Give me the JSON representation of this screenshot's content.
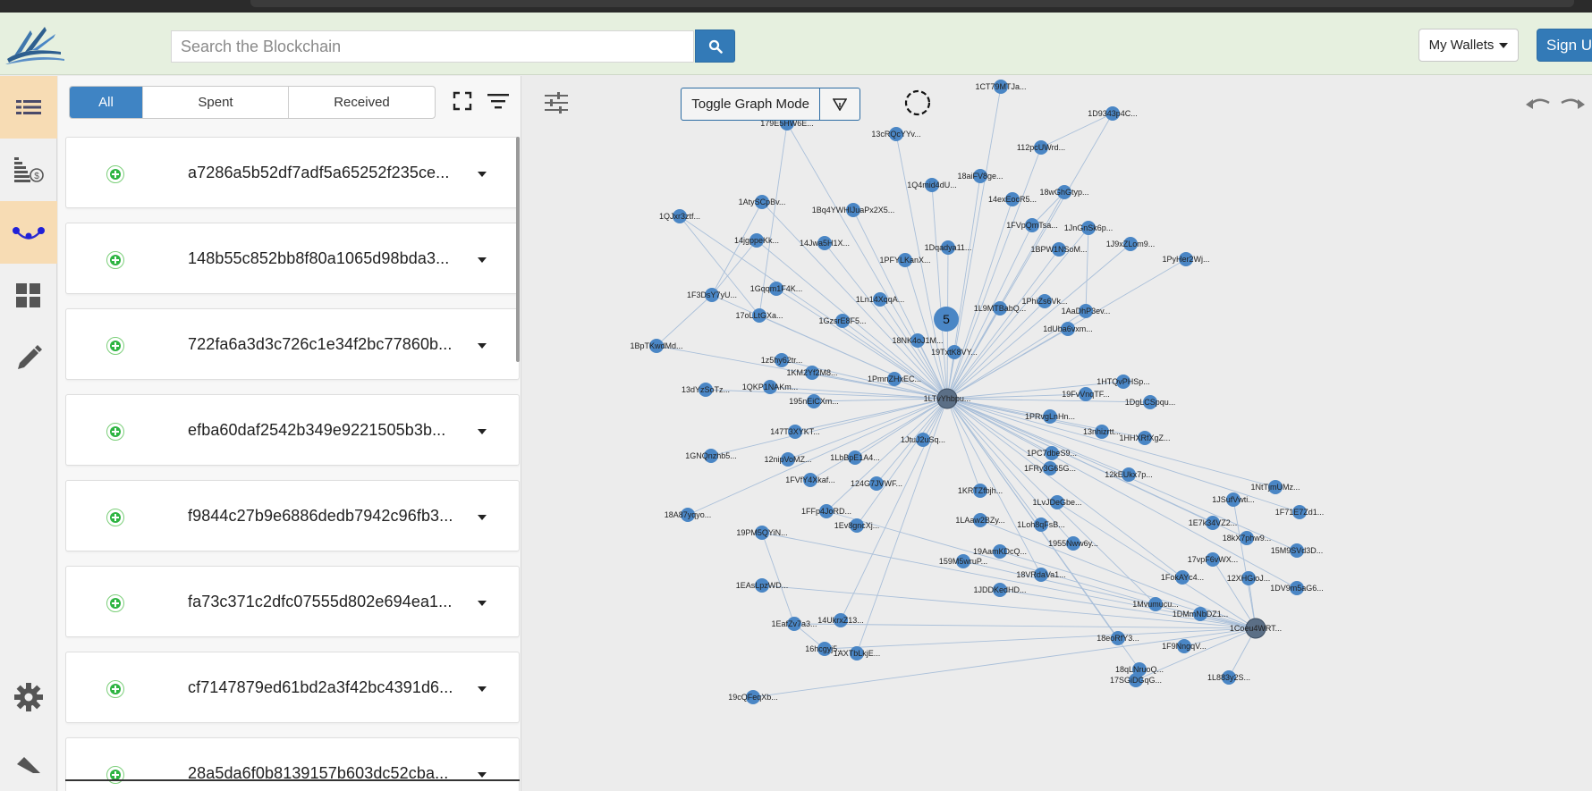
{
  "header": {
    "search_placeholder": "Search the Blockchain",
    "wallets_label": "My Wallets",
    "signup_label": "Sign Up"
  },
  "filters": {
    "all": "All",
    "spent": "Spent",
    "received": "Received"
  },
  "transactions": [
    "a7286a5b52df7adf5a65252f235ce...",
    "148b55c852bb8f80a1065d98bda3...",
    "722fa6a3d3c726c1e34f2bc77860b...",
    "efba60daf2542b349e9221505b3b...",
    "f9844c27b9e6886dedb7942c96fb3...",
    "fa73c371c2dfc07555d802e694ea1...",
    "cf7147879ed61bd2a3f42bc4391d6...",
    "28a5da6f0b8139157b603dc52cba..."
  ],
  "graph": {
    "toggle_label": "Toggle Graph Mode",
    "cluster_count": "5",
    "hubs": [
      {
        "id": "h1",
        "label": "1LTvYhbpu..."
      },
      {
        "id": "h2",
        "label": "1Coeu4WRT..."
      }
    ],
    "nodes": [
      {
        "label": "1CT79MTJa...",
        "hub": "h1"
      },
      {
        "label": "1D9343p4C...",
        "hub": "h1"
      },
      {
        "label": "179E5HW6E...",
        "hub": "h1"
      },
      {
        "label": "13cRQcYYv...",
        "hub": "h1"
      },
      {
        "label": "112pcUWrd...",
        "hub": "h1"
      },
      {
        "label": "18aiFV8ge...",
        "hub": "h1"
      },
      {
        "label": "1Q4mid4dU...",
        "hub": "h1"
      },
      {
        "label": "18wGhGtyp...",
        "hub": "h1"
      },
      {
        "label": "14exEocR5...",
        "hub": "h1"
      },
      {
        "label": "1AtySCpBv...",
        "hub": "h1"
      },
      {
        "label": "1Bq4YWHlJuaPx2X5...",
        "hub": "h1"
      },
      {
        "label": "1QJxr3ztf...",
        "hub": "h1"
      },
      {
        "label": "1FVpQmTsa...",
        "hub": "h1"
      },
      {
        "label": "1JnGnSk6p...",
        "hub": "h1"
      },
      {
        "label": "14jgppeKk...",
        "hub": "h1"
      },
      {
        "label": "14Jwa5H1X...",
        "hub": "h1"
      },
      {
        "label": "1Dqadya11...",
        "hub": "h1"
      },
      {
        "label": "1BPW1NSoM...",
        "hub": "h1"
      },
      {
        "label": "1J9xZLom9...",
        "hub": "h1"
      },
      {
        "label": "1PFYLKanX...",
        "hub": "h1"
      },
      {
        "label": "1PyHer2Wj...",
        "hub": "h1"
      },
      {
        "label": "1F3DsY7yU...",
        "hub": "h1"
      },
      {
        "label": "1Gqqm1F4K...",
        "hub": "h1"
      },
      {
        "label": "1Ln14XqqA...",
        "hub": "h1"
      },
      {
        "label": "1L9MTBabQ...",
        "hub": "h1"
      },
      {
        "label": "1PhiZs6Vk...",
        "hub": "h1"
      },
      {
        "label": "1AaDhP3ev...",
        "hub": "h1"
      },
      {
        "label": "17oLLtGXa...",
        "hub": "h1"
      },
      {
        "label": "1GzsrE8F5...",
        "hub": "h1"
      },
      {
        "label": "1dUba6vxm...",
        "hub": "h1"
      },
      {
        "label": "1BpTKwdMd...",
        "hub": "h1"
      },
      {
        "label": "18NK4oJ1M...",
        "hub": "h1"
      },
      {
        "label": "19TxtK8VY...",
        "hub": "h1"
      },
      {
        "label": "1z5hy62tr...",
        "hub": "h1"
      },
      {
        "label": "1KM2Yf2M8...",
        "hub": "h1"
      },
      {
        "label": "1PmnZHxEC...",
        "hub": "h1"
      },
      {
        "label": "13dYzSoTz...",
        "hub": "h1"
      },
      {
        "label": "1QKP1NAKm...",
        "hub": "h1"
      },
      {
        "label": "1HTQvPHSp...",
        "hub": "h1"
      },
      {
        "label": "195nEiCXm...",
        "hub": "h1"
      },
      {
        "label": "19FvVnqTF...",
        "hub": "h1"
      },
      {
        "label": "1DgLCSpqu...",
        "hub": "h1"
      },
      {
        "label": "1PRvgLnHn...",
        "hub": "h1"
      },
      {
        "label": "147T3XYKT...",
        "hub": "h1"
      },
      {
        "label": "13nhizrtt...",
        "hub": "h1"
      },
      {
        "label": "1HHXRfXgZ...",
        "hub": "h1"
      },
      {
        "label": "1JtuJ2uSq...",
        "hub": "h1"
      },
      {
        "label": "1GNQnzhb5...",
        "hub": "h1"
      },
      {
        "label": "12nipVoMZ...",
        "hub": "h1"
      },
      {
        "label": "1LbBpE1A4...",
        "hub": "h1"
      },
      {
        "label": "1PC7dbeS9...",
        "hub": "h1"
      },
      {
        "label": "1FRy3G65G...",
        "hub": "h1"
      },
      {
        "label": "12kEUkx7p...",
        "hub": "h1"
      },
      {
        "label": "1FVfY4Xkaf...",
        "hub": "h1"
      },
      {
        "label": "124G7JVWF...",
        "hub": "h1"
      },
      {
        "label": "1KRTZfbjh...",
        "hub": "h1"
      },
      {
        "label": "1NtTjmUMz...",
        "hub": "h1"
      },
      {
        "label": "1JSufVwti...",
        "hub": "h2"
      },
      {
        "label": "1LvJDeGbe...",
        "hub": "h2"
      },
      {
        "label": "18A87yqyo...",
        "hub": "h1"
      },
      {
        "label": "1FFp4JoRD...",
        "hub": "h1"
      },
      {
        "label": "1F71E7Zd1...",
        "hub": "h1"
      },
      {
        "label": "1LAaw2BZy...",
        "hub": "h2"
      },
      {
        "label": "1Loh8qFsB...",
        "hub": "h1"
      },
      {
        "label": "1E7k34VZ2...",
        "hub": "h1"
      },
      {
        "label": "19PM5QYiN...",
        "hub": "h2"
      },
      {
        "label": "1Ev8gncXj...",
        "hub": "h1"
      },
      {
        "label": "1955Nww6y...",
        "hub": "h1"
      },
      {
        "label": "18kX7phw9...",
        "hub": "h1"
      },
      {
        "label": "19AamKDcQ...",
        "hub": "h2"
      },
      {
        "label": "15M9SVd3D...",
        "hub": "h1"
      },
      {
        "label": "17vpF6vWX...",
        "hub": "h2"
      },
      {
        "label": "159M5wruP...",
        "hub": "h2"
      },
      {
        "label": "18VRdaVa1...",
        "hub": "h1"
      },
      {
        "label": "1FokAYc4...",
        "hub": "h1"
      },
      {
        "label": "12XHGioJ...",
        "hub": "h2"
      },
      {
        "label": "1JDDKedHD...",
        "hub": "h2"
      },
      {
        "label": "1DV9m5aG6...",
        "hub": "h1"
      },
      {
        "label": "1EAsLpzWD...",
        "hub": "h2"
      },
      {
        "label": "1Mvumucu...",
        "hub": "h1"
      },
      {
        "label": "1DMmNbDZ1...",
        "hub": "h2"
      },
      {
        "label": "1EafZv7a3...",
        "hub": "h2"
      },
      {
        "label": "14UkrxZ13...",
        "hub": "h1"
      },
      {
        "label": "18eoRfY3...",
        "hub": "h1"
      },
      {
        "label": "1F9NngqV...",
        "hub": "h2"
      },
      {
        "label": "16hcgyj5...",
        "hub": "h2"
      },
      {
        "label": "1AXTbLkjE...",
        "hub": "h1"
      },
      {
        "label": "18qLNruoQ...",
        "hub": "h1"
      },
      {
        "label": "17SGiDGqG...",
        "hub": "h2"
      },
      {
        "label": "1L883y2S...",
        "hub": "h2"
      },
      {
        "label": "19cQFeqXb...",
        "hub": "h2"
      },
      {
        "label": "12AqZMaUY...",
        "hub": "h1"
      }
    ]
  },
  "colors": {
    "accent": "#337ab7",
    "node": "#4a86c5",
    "edge": "#a9bfd9",
    "topbar": "#e6f0df",
    "sidebar_active": "#f7dcb4",
    "success": "#2db441"
  },
  "icons": {
    "sidebar": [
      "transactions-list-icon",
      "wallet-coins-icon",
      "graph-network-icon",
      "dashboard-grid-icon",
      "pencil-icon",
      "gear-icon",
      "ruler-icon"
    ]
  }
}
